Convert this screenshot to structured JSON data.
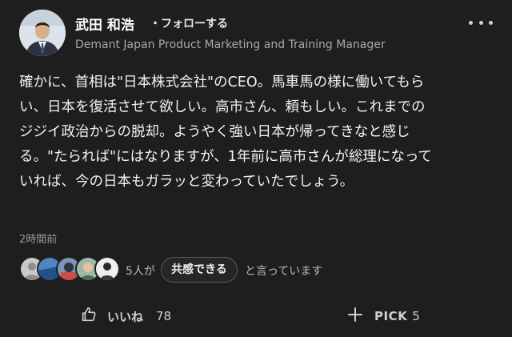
{
  "post": {
    "author": {
      "name": "武田 和浩",
      "follow_label": "・フォローする",
      "title": "Demant Japan Product Marketing and Training Manager"
    },
    "body_lines": [
      "確かに、首相は\"日本株式会社\"のCEO。馬車馬の様に働いてもら",
      "い、日本を復活させて欲しい。高市さん、頼もしい。これまでの",
      "ジジイ政治からの脱却。ようやく強い日本が帰ってきなと感じ",
      "る。\"たられば\"にはなりますが、1年前に高市さんが総理になって",
      "いれば、今の日本もガラッと変わっていたでしょう。"
    ],
    "timestamp": "2時間前"
  },
  "empathy": {
    "count_text": "5人が",
    "button_label": "共感できる",
    "suffix_text": "と言っています"
  },
  "actions": {
    "like_label": "いいね",
    "like_count": "78",
    "pick_label": "PICK",
    "pick_count": "5"
  },
  "colors": {
    "background": "#1e1e1e",
    "text": "#f2f2f2",
    "muted": "#a8a8a8"
  },
  "icons": [
    "more-icon",
    "thumbs-up-icon",
    "plus-icon"
  ]
}
